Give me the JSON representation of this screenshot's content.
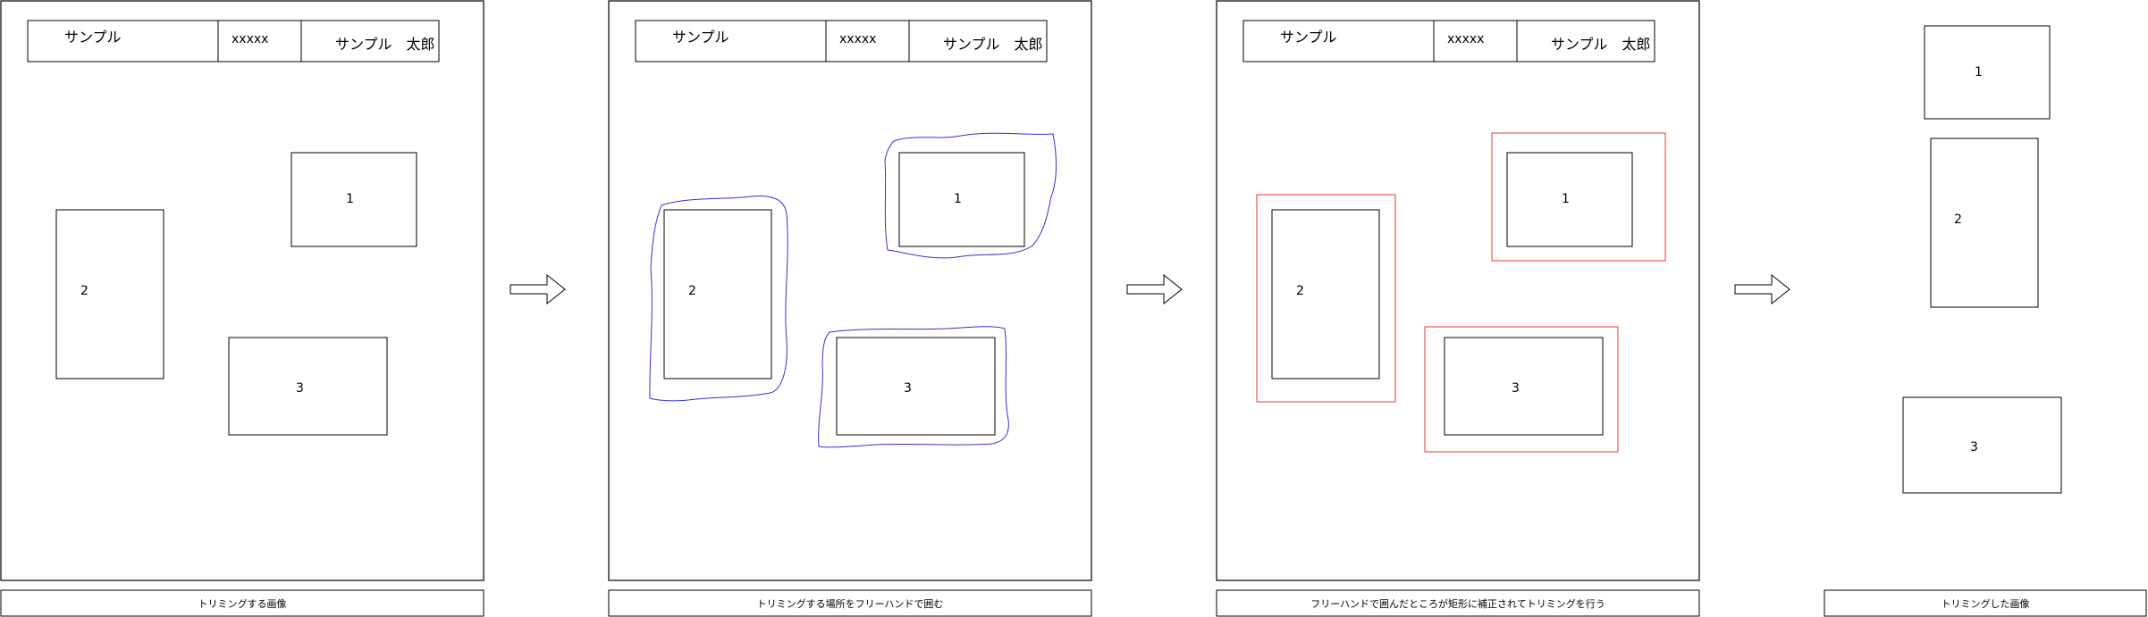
{
  "colors": {
    "stroke": "#000000",
    "freehand": "#3333cc",
    "corrected": "#ee3333",
    "background": "#ffffff"
  },
  "header": {
    "name": "サンプル",
    "code": "xxxxx",
    "user": "サンプル　太郎"
  },
  "boxes": {
    "one": "1",
    "two": "2",
    "three": "3"
  },
  "captions": [
    "トリミングする画像",
    "トリミングする場所をフリーハンドで囲む",
    "フリーハンドで囲んだところが矩形に補正されてトリミングを行う",
    "トリミングした画像"
  ],
  "arrow_icon": "right-arrow-icon"
}
